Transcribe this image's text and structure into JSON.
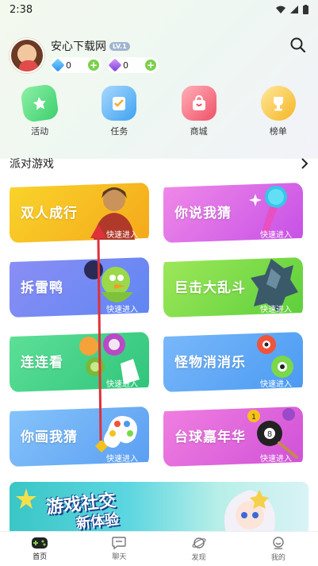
{
  "status_bar": {
    "time": "2:38",
    "wifi_icon": "wifi-icon",
    "signal_icon": "signal-icon",
    "battery_icon": "battery-icon"
  },
  "profile": {
    "nickname": "安心下载网",
    "level_badge": "LV.1",
    "currencies": [
      {
        "icon": "blue-diamond-icon",
        "amount": "0"
      },
      {
        "icon": "purple-gem-icon",
        "amount": "0"
      }
    ]
  },
  "quick_nav": [
    {
      "label": "活动",
      "icon": "activity-icon"
    },
    {
      "label": "任务",
      "icon": "task-icon"
    },
    {
      "label": "商城",
      "icon": "shop-bag-icon"
    },
    {
      "label": "榜单",
      "icon": "trophy-icon"
    }
  ],
  "section": {
    "title": "派对游戏"
  },
  "games": [
    {
      "name": "双人成行",
      "enter": "快速进入",
      "color": "#f7c21a"
    },
    {
      "name": "你说我猜",
      "enter": "快速进入",
      "color": "#e45fe0"
    },
    {
      "name": "拆雷鸭",
      "enter": "快速进入",
      "color": "#6c7cf0"
    },
    {
      "name": "巨击大乱斗",
      "enter": "快速进入",
      "color": "#7ed23c"
    },
    {
      "name": "连连看",
      "enter": "快速进入",
      "color": "#3fcf8a"
    },
    {
      "name": "怪物消消乐",
      "enter": "快速进入",
      "color": "#5aa4f5"
    },
    {
      "name": "你画我猜",
      "enter": "快速进入",
      "color": "#6aa8f5"
    },
    {
      "name": "台球嘉年华",
      "enter": "快速进入",
      "color": "#e060d8"
    }
  ],
  "banner": {
    "line1": "游戏社交",
    "line2": "新体验"
  },
  "tabs": [
    {
      "label": "首页",
      "icon": "gamepad-icon",
      "active": true
    },
    {
      "label": "聊天",
      "icon": "chat-icon",
      "active": false
    },
    {
      "label": "发现",
      "icon": "planet-icon",
      "active": false
    },
    {
      "label": "我的",
      "icon": "profile-icon",
      "active": false
    }
  ],
  "colors": {
    "accent_green": "#7ad04a",
    "annotation_red": "#e0303a"
  }
}
